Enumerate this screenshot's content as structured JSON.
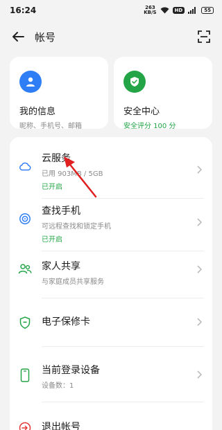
{
  "status": {
    "time": "16:24",
    "net_speed_top": "263",
    "net_speed_bottom": "KB/S",
    "hd": "HD",
    "battery": "55"
  },
  "header": {
    "title": "帐号"
  },
  "cards": {
    "info": {
      "title": "我的信息",
      "subtitle": "昵称、手机号、邮箱"
    },
    "security": {
      "title": "安全中心",
      "subtitle": "安全评分 100 分"
    }
  },
  "items": [
    {
      "title": "云服务",
      "subtitle": "已用 903MB / 5GB",
      "status": "已开启"
    },
    {
      "title": "查找手机",
      "subtitle": "可远程查找和锁定手机",
      "status": "已开启"
    },
    {
      "title": "家人共享",
      "subtitle": "与家庭成员共享服务"
    },
    {
      "title": "电子保修卡"
    },
    {
      "title": "当前登录设备",
      "subtitle": "设备数：1"
    },
    {
      "title": "退出帐号"
    }
  ],
  "colors": {
    "accent_blue": "#2f7ef5",
    "green": "#23a447",
    "red": "#e53935"
  }
}
